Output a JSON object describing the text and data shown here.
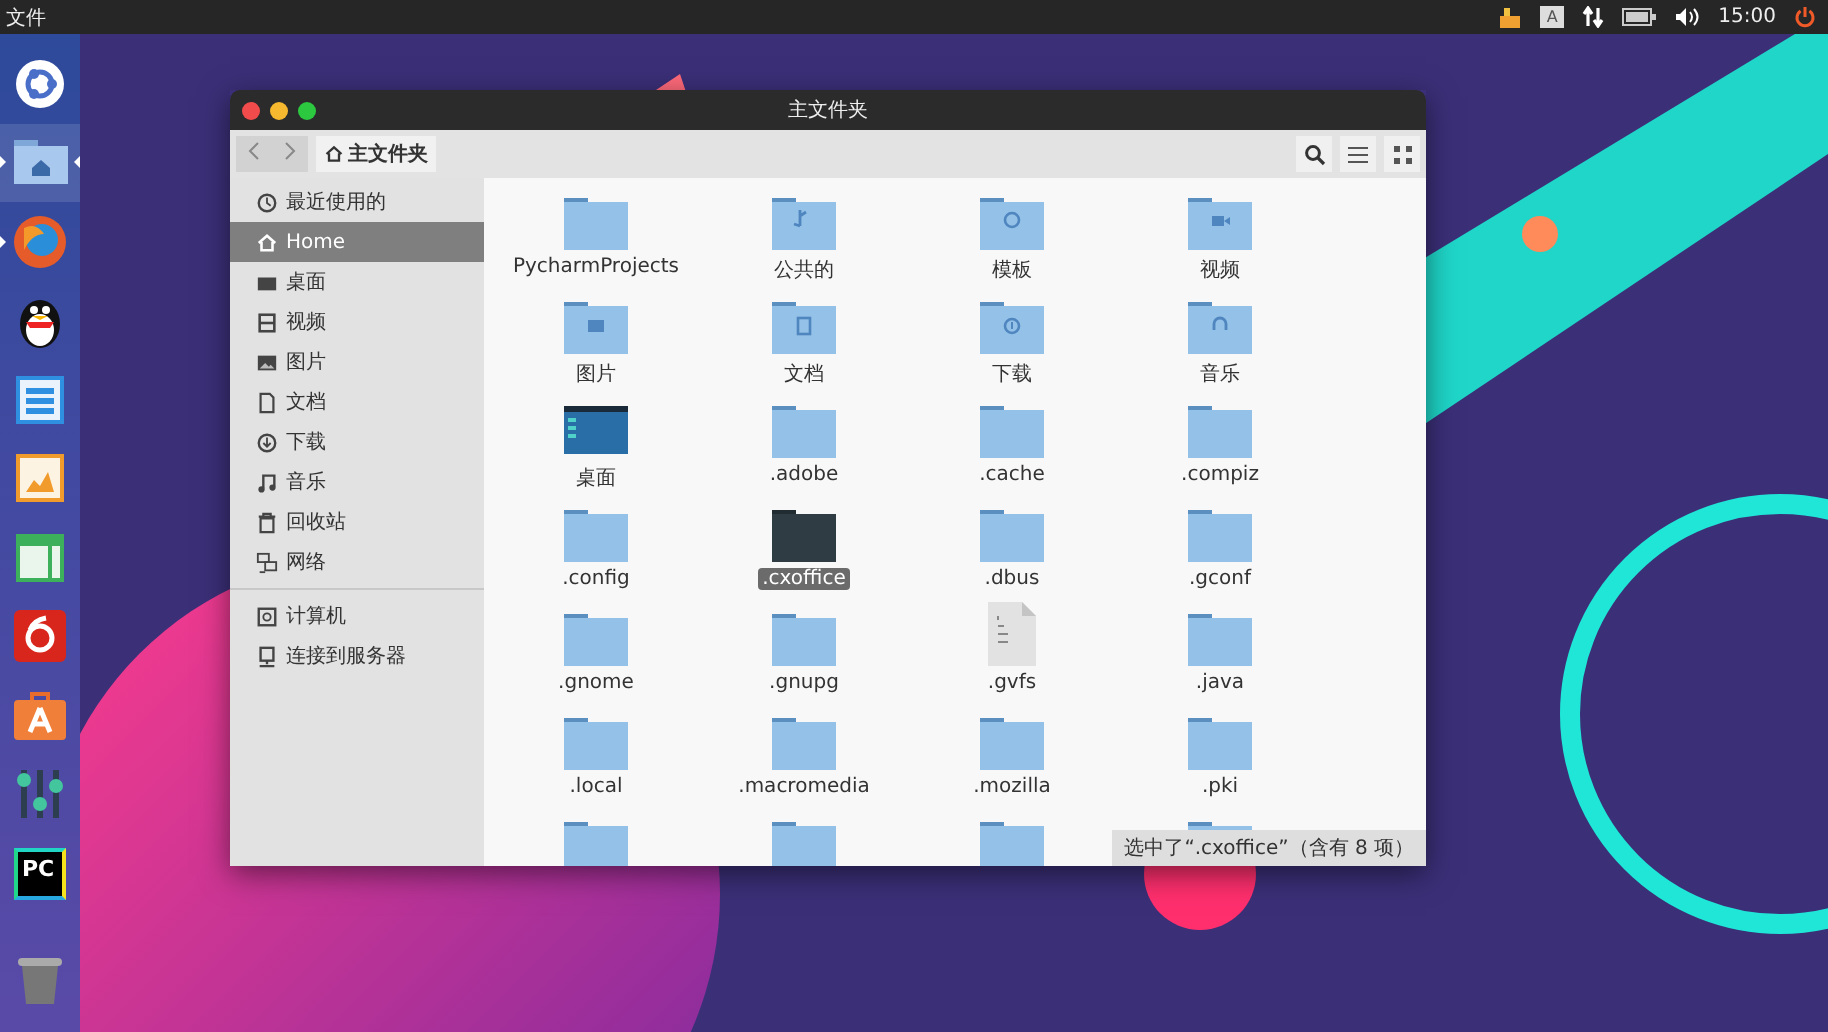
{
  "top_bar": {
    "app_menu": "文件",
    "input_method": "A",
    "clock": "15:00"
  },
  "launcher": [
    {
      "kind": "dash",
      "running": false,
      "focused": false
    },
    {
      "kind": "home",
      "running": true,
      "focused": true
    },
    {
      "kind": "browser",
      "running": true,
      "focused": false
    },
    {
      "kind": "penguin",
      "running": false,
      "focused": false
    },
    {
      "kind": "writer",
      "running": false,
      "focused": false
    },
    {
      "kind": "impress",
      "running": false,
      "focused": false
    },
    {
      "kind": "calc",
      "running": false,
      "focused": false
    },
    {
      "kind": "music",
      "running": false,
      "focused": false
    },
    {
      "kind": "store",
      "running": false,
      "focused": false
    },
    {
      "kind": "mixer",
      "running": false,
      "focused": false
    },
    {
      "kind": "ide",
      "label": "PC",
      "running": false,
      "focused": false
    },
    {
      "kind": "trash",
      "running": false,
      "focused": false
    }
  ],
  "window": {
    "title": "主文件夹",
    "path": "主文件夹",
    "sidebar": {
      "places": [
        {
          "kind": "recent",
          "label": "最近使用的",
          "selected": false
        },
        {
          "kind": "home",
          "label": "Home",
          "selected": true
        },
        {
          "kind": "desktop",
          "label": "桌面",
          "selected": false
        },
        {
          "kind": "video",
          "label": "视频",
          "selected": false
        },
        {
          "kind": "pictures",
          "label": "图片",
          "selected": false
        },
        {
          "kind": "docs",
          "label": "文档",
          "selected": false
        },
        {
          "kind": "download",
          "label": "下载",
          "selected": false
        },
        {
          "kind": "music",
          "label": "音乐",
          "selected": false
        },
        {
          "kind": "trash",
          "label": "回收站",
          "selected": false
        },
        {
          "kind": "network",
          "label": "网络",
          "selected": false
        }
      ],
      "devices": [
        {
          "kind": "computer",
          "label": "计算机",
          "selected": false
        },
        {
          "kind": "server",
          "label": "连接到服务器",
          "selected": false
        }
      ]
    },
    "files": [
      {
        "kind": "folder",
        "name": "PycharmProjects",
        "selected": false
      },
      {
        "kind": "share",
        "name": "公共的",
        "selected": false
      },
      {
        "kind": "templates",
        "name": "模板",
        "selected": false
      },
      {
        "kind": "video",
        "name": "视频",
        "selected": false
      },
      {
        "kind": "pictures",
        "name": "图片",
        "selected": false
      },
      {
        "kind": "docs",
        "name": "文档",
        "selected": false
      },
      {
        "kind": "download",
        "name": "下载",
        "selected": false
      },
      {
        "kind": "music",
        "name": "音乐",
        "selected": false
      },
      {
        "kind": "desktop",
        "name": "桌面",
        "selected": false
      },
      {
        "kind": "folder",
        "name": ".adobe",
        "selected": false
      },
      {
        "kind": "folder",
        "name": ".cache",
        "selected": false
      },
      {
        "kind": "folder",
        "name": ".compiz",
        "selected": false
      },
      {
        "kind": "folder",
        "name": ".config",
        "selected": false
      },
      {
        "kind": "folder",
        "name": ".cxoffice",
        "selected": true
      },
      {
        "kind": "folder",
        "name": ".dbus",
        "selected": false
      },
      {
        "kind": "folder",
        "name": ".gconf",
        "selected": false
      },
      {
        "kind": "folder",
        "name": ".gnome",
        "selected": false
      },
      {
        "kind": "folder",
        "name": ".gnupg",
        "selected": false
      },
      {
        "kind": "binary",
        "name": ".gvfs",
        "selected": false
      },
      {
        "kind": "folder",
        "name": ".java",
        "selected": false
      },
      {
        "kind": "folder",
        "name": ".local",
        "selected": false
      },
      {
        "kind": "folder",
        "name": ".macromedia",
        "selected": false
      },
      {
        "kind": "folder",
        "name": ".mozilla",
        "selected": false
      },
      {
        "kind": "folder",
        "name": ".pki",
        "selected": false
      },
      {
        "kind": "folder",
        "selected": false
      },
      {
        "kind": "folder",
        "selected": false
      },
      {
        "kind": "folder",
        "selected": false
      },
      {
        "kind": "folder",
        "selected": false
      }
    ],
    "status": "选中了“.cxoffice”（含有 8 项）"
  }
}
